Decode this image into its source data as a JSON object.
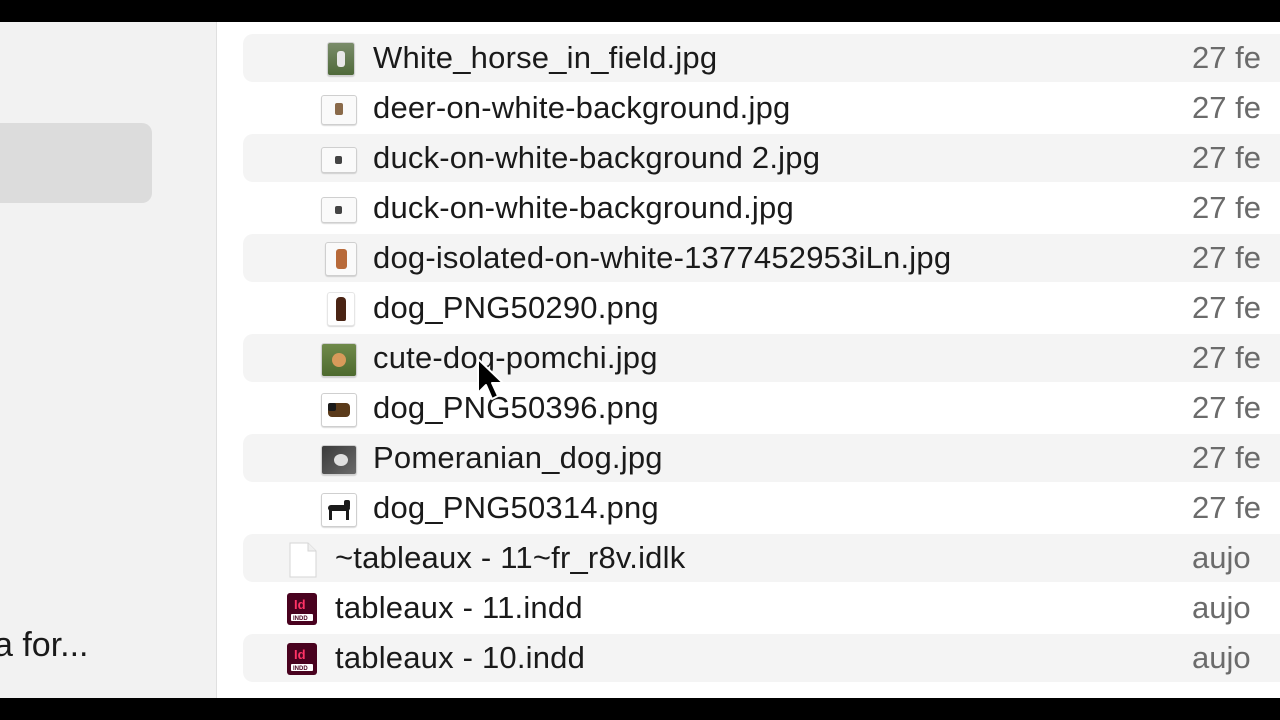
{
  "sidebar": {
    "bottom_label": "a for..."
  },
  "files": [
    {
      "name": "White_horse_in_field.jpg",
      "date": "27 fe",
      "icon": "photo-thumbnail-icon"
    },
    {
      "name": "deer-on-white-background.jpg",
      "date": "27 fe",
      "icon": "photo-thumbnail-icon"
    },
    {
      "name": "duck-on-white-background 2.jpg",
      "date": "27 fe",
      "icon": "photo-thumbnail-icon"
    },
    {
      "name": "duck-on-white-background.jpg",
      "date": "27 fe",
      "icon": "photo-thumbnail-icon"
    },
    {
      "name": "dog-isolated-on-white-1377452953iLn.jpg",
      "date": "27 fe",
      "icon": "photo-thumbnail-icon"
    },
    {
      "name": "dog_PNG50290.png",
      "date": "27 fe",
      "icon": "photo-thumbnail-icon"
    },
    {
      "name": "cute-dog-pomchi.jpg",
      "date": "27 fe",
      "icon": "photo-thumbnail-icon"
    },
    {
      "name": "dog_PNG50396.png",
      "date": "27 fe",
      "icon": "photo-thumbnail-icon"
    },
    {
      "name": "Pomeranian_dog.jpg",
      "date": "27 fe",
      "icon": "photo-thumbnail-icon"
    },
    {
      "name": "dog_PNG50314.png",
      "date": "27 fe",
      "icon": "photo-thumbnail-icon"
    },
    {
      "name": "~tableaux - 11~fr_r8v.idlk",
      "date": "aujo",
      "icon": "blank-document-icon"
    },
    {
      "name": "tableaux - 11.indd",
      "date": "aujo",
      "icon": "indesign-document-icon"
    },
    {
      "name": "tableaux - 10.indd",
      "date": "aujo",
      "icon": "indesign-document-icon"
    }
  ],
  "colors": {
    "indesign_badge": "#49021f",
    "indesign_text": "#ff3366",
    "stripe": "#f4f4f4"
  }
}
